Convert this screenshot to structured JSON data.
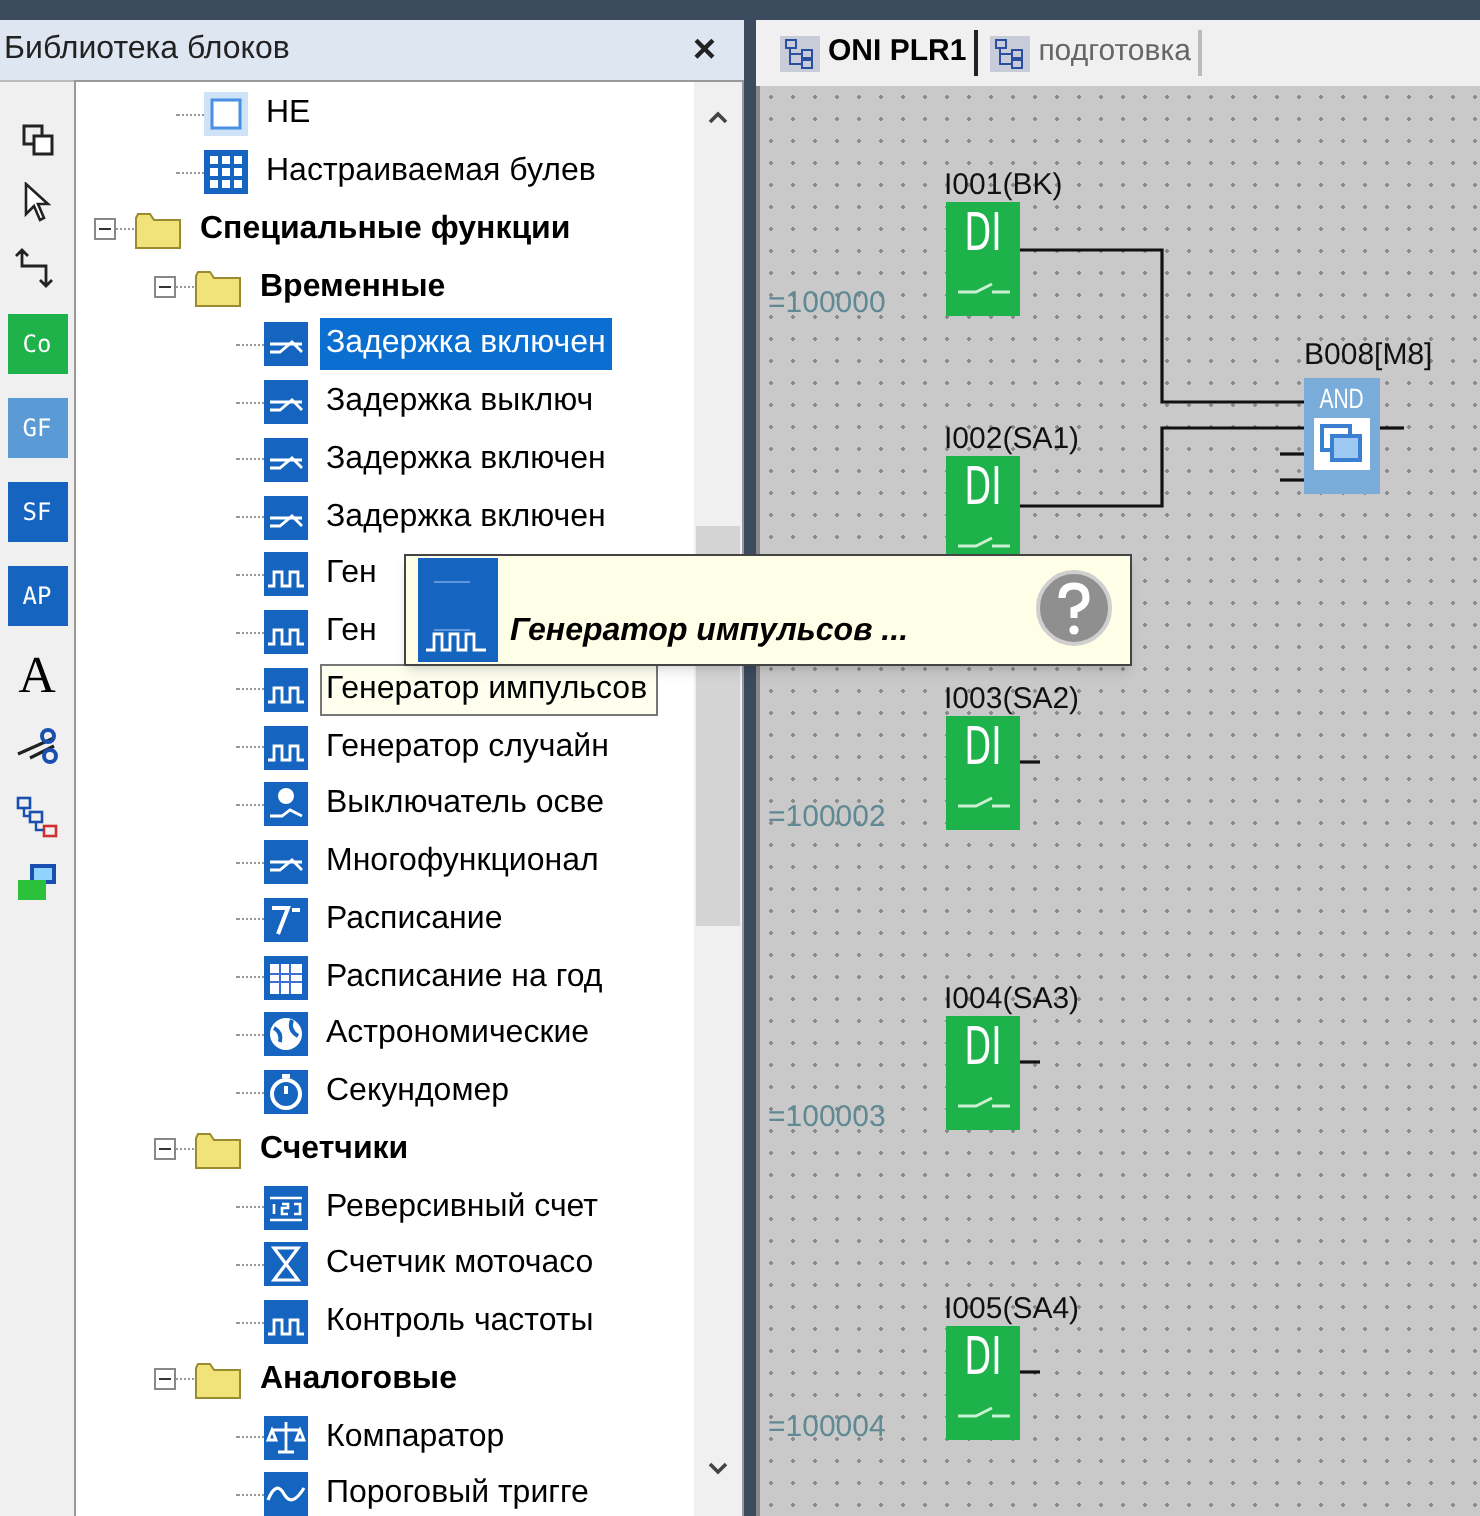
{
  "panel": {
    "title": "Библиотека блоков",
    "close": "×"
  },
  "toolbar": [
    {
      "kind": "overlap"
    },
    {
      "kind": "pointer"
    },
    {
      "kind": "connector"
    },
    {
      "kind": "badge",
      "label": "Co",
      "color": "#1fb24a"
    },
    {
      "kind": "badge",
      "label": "GF",
      "color": "#5b9bd5"
    },
    {
      "kind": "badge",
      "label": "SF",
      "color": "#1565c0"
    },
    {
      "kind": "badge",
      "label": "AP",
      "color": "#1565c0"
    },
    {
      "kind": "letter",
      "label": "A"
    },
    {
      "kind": "scissors"
    },
    {
      "kind": "network"
    },
    {
      "kind": "monitor"
    }
  ],
  "tree": [
    {
      "kind": "group",
      "children": [
        {
          "kind": "square",
          "label": "НЕ",
          "selected": false,
          "hovered": false
        },
        {
          "kind": "grid",
          "label": "Настраиваемая булев",
          "selected": false,
          "hovered": false
        }
      ]
    },
    {
      "kind": "folder",
      "label": "Специальные функции",
      "expanded": true,
      "children": [
        {
          "kind": "folder",
          "label": "Временные",
          "expanded": true,
          "children": [
            {
              "kind": "delay",
              "label": "Задержка включен",
              "selected": true,
              "hovered": false
            },
            {
              "kind": "delay",
              "label": "Задержка выключ",
              "selected": false,
              "hovered": false
            },
            {
              "kind": "delay",
              "label": "Задержка включен",
              "selected": false,
              "hovered": false
            },
            {
              "kind": "delay",
              "label": "Задержка включен",
              "selected": false,
              "hovered": false
            },
            {
              "kind": "pulse",
              "label": "Ген",
              "selected": false,
              "hovered": false
            },
            {
              "kind": "pulse",
              "label": "Ген",
              "selected": false,
              "hovered": false
            },
            {
              "kind": "pulse",
              "label": "Генератор импульсов",
              "selected": false,
              "hovered": true
            },
            {
              "kind": "pulse",
              "label": "Генератор случайн",
              "selected": false,
              "hovered": false
            },
            {
              "kind": "lamp",
              "label": "Выключатель осве",
              "selected": false,
              "hovered": false
            },
            {
              "kind": "delay",
              "label": "Многофункционал",
              "selected": false,
              "hovered": false
            },
            {
              "kind": "week",
              "label": "Расписание",
              "selected": false,
              "hovered": false
            },
            {
              "kind": "calendar",
              "label": "Расписание на год",
              "selected": false,
              "hovered": false
            },
            {
              "kind": "globe",
              "label": "Астрономические",
              "selected": false,
              "hovered": false
            },
            {
              "kind": "stopwatch",
              "label": "Секундомер",
              "selected": false,
              "hovered": false
            }
          ]
        },
        {
          "kind": "folder",
          "label": "Счетчики",
          "expanded": true,
          "children": [
            {
              "kind": "counter",
              "label": "Реверсивный счет",
              "selected": false,
              "hovered": false
            },
            {
              "kind": "hourglass",
              "label": "Счетчик моточасо",
              "selected": false,
              "hovered": false
            },
            {
              "kind": "pulse",
              "label": "Контроль частоты",
              "selected": false,
              "hovered": false
            }
          ]
        },
        {
          "kind": "folder",
          "label": "Аналоговые",
          "expanded": true,
          "children": [
            {
              "kind": "scale",
              "label": "Компаратор",
              "selected": false,
              "hovered": false
            },
            {
              "kind": "wave",
              "label": "Пороговый тригге",
              "selected": false,
              "hovered": false
            }
          ]
        }
      ]
    }
  ],
  "tooltip": {
    "text": "Генератор импульсов ..."
  },
  "tabs": [
    {
      "label": "ONI PLR1",
      "selected": true
    },
    {
      "label": "подготовка",
      "selected": false
    }
  ],
  "canvas": {
    "inputs": [
      {
        "label": "I001(BK)",
        "text": "DI",
        "address": "=100000"
      },
      {
        "label": "I002(SA1)",
        "text": "DI"
      },
      {
        "label": "I003(SA2)",
        "text": "DI",
        "address": "=100002"
      },
      {
        "label": "I004(SA3)",
        "text": "DI",
        "address": "=100003"
      },
      {
        "label": "I005(SA4)",
        "text": "DI",
        "address": "=100004"
      }
    ],
    "gate": {
      "label": "B008[M8]",
      "text": "AND"
    }
  }
}
